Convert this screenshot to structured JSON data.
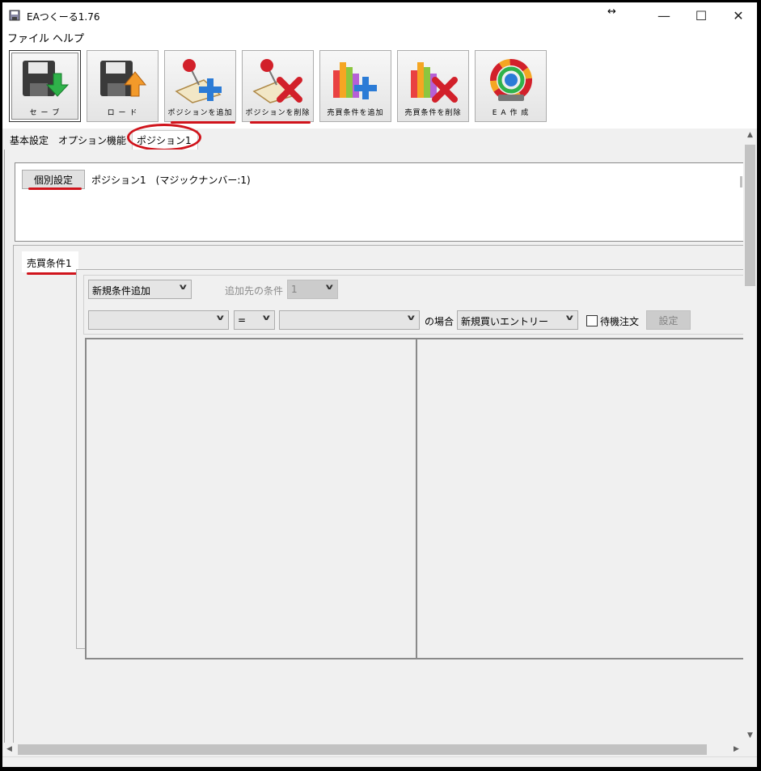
{
  "window": {
    "title": "EAつくーる1.76",
    "resize_glyph": "↔",
    "minimize": "—",
    "maximize": "☐",
    "close": "✕"
  },
  "menu": {
    "file": "ファイル",
    "help": "ヘルプ"
  },
  "toolbar": {
    "save": "セ ー ブ",
    "load": "ロ ー ド",
    "add_position": "ポジションを追加",
    "delete_position": "ポジションを削除",
    "add_trade_condition": "売買条件を追加",
    "delete_trade_condition": "売買条件を削除",
    "create_ea": "E A 作 成"
  },
  "tabs": {
    "basic": "基本設定",
    "options": "オプション機能",
    "position1": "ポジション1"
  },
  "position_panel": {
    "button": "個別設定",
    "label": "ポジション1　(マジックナンバー:1)"
  },
  "trade_tab": "売買条件1",
  "conditions": {
    "new_condition_select": "新規条件追加",
    "add_target_label": "追加先の条件",
    "add_target_value": "1",
    "left_select": "",
    "operator_select": "=",
    "right_select": "",
    "case_label": "の場合",
    "entry_select": "新規買いエントリー",
    "pending_order_label": "待機注文",
    "set_button": "設定"
  },
  "accent_color": "#d0141c"
}
